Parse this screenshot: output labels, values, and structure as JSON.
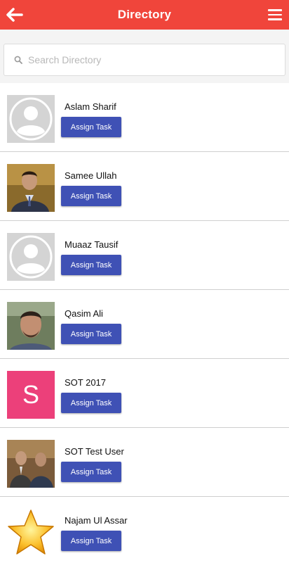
{
  "header": {
    "title": "Directory",
    "back_icon": "arrow-left-icon",
    "menu_icon": "hamburger-menu-icon",
    "color": "#f0453b"
  },
  "search": {
    "placeholder": "Search Directory",
    "value": "",
    "icon": "search-icon"
  },
  "accent": "#3f51b5",
  "contacts": [
    {
      "name": "Aslam Sharif",
      "avatar": "default-user-icon",
      "action": "Assign Task"
    },
    {
      "name": "Samee Ullah",
      "avatar": "photo",
      "action": "Assign Task"
    },
    {
      "name": "Muaaz Tausif",
      "avatar": "default-user-icon",
      "action": "Assign Task"
    },
    {
      "name": "Qasim Ali",
      "avatar": "photo",
      "action": "Assign Task"
    },
    {
      "name": "SOT 2017",
      "avatar": "letter",
      "avatar_letter": "S",
      "avatar_color": "#ec407a",
      "action": "Assign Task"
    },
    {
      "name": "SOT Test User",
      "avatar": "photo",
      "action": "Assign Task"
    },
    {
      "name": "Najam Ul Assar",
      "avatar": "star-icon",
      "action": "Assign Task"
    }
  ]
}
